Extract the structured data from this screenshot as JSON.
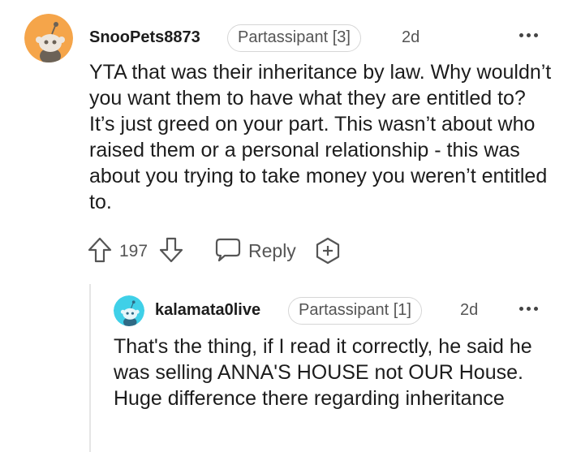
{
  "comment": {
    "username": "SnooPets8873",
    "flair": "Partassipant [3]",
    "time": "2d",
    "body": "YTA that was their inheritance by law. Why wouldn’t you want them to have what they are entitled to? It’s just greed on your part. This wasn’t about who raised them or a personal relationship - this was about you trying to take money you weren’t entitled to.",
    "votes": "197",
    "reply_label": "Reply",
    "avatar_color": "#f5a54a"
  },
  "reply": {
    "username": "kalamata0live",
    "flair": "Partassipant [1]",
    "time": "2d",
    "body": "That's the thing, if I read it correctly, he said he was selling ANNA'S HOUSE not OUR House. Huge difference there regarding inheritance",
    "avatar_color": "#3fd0e8"
  },
  "icons": {
    "upvote": "arrow-up-icon",
    "downvote": "arrow-down-icon",
    "reply": "speech-bubble-icon",
    "award": "add-award-icon",
    "more": "more-horizontal-icon"
  }
}
